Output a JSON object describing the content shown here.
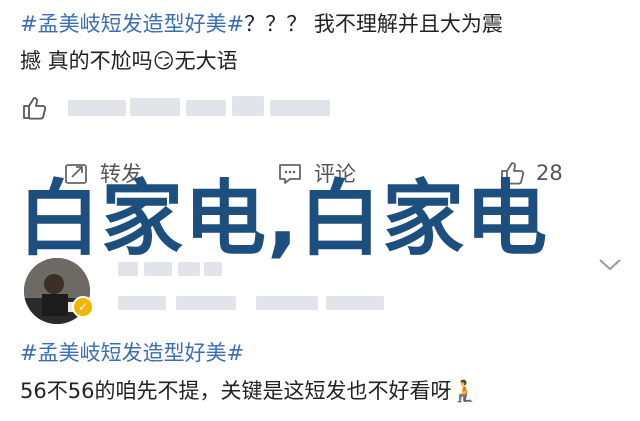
{
  "post1": {
    "hashtag": "#孟美岐短发造型好美#",
    "text_line1": "？？？ 我不理解并且大为震",
    "text_line2_prefix": "撼 真的不尬吗",
    "emoji": "😏",
    "text_line2_suffix": "无大语"
  },
  "actions": {
    "repost_label": "转发",
    "comment_label": "评论",
    "like_count": "28"
  },
  "watermark": "白家电,白家电",
  "post2": {
    "hashtag": "#孟美岐短发造型好美#",
    "text": "56不56的咱先不提，关键是这短发也不好看呀",
    "emoji": "🧎"
  },
  "colors": {
    "hashtag": "#3a6db5",
    "watermark": "#1d4f7e",
    "verified": "#f0b500"
  }
}
